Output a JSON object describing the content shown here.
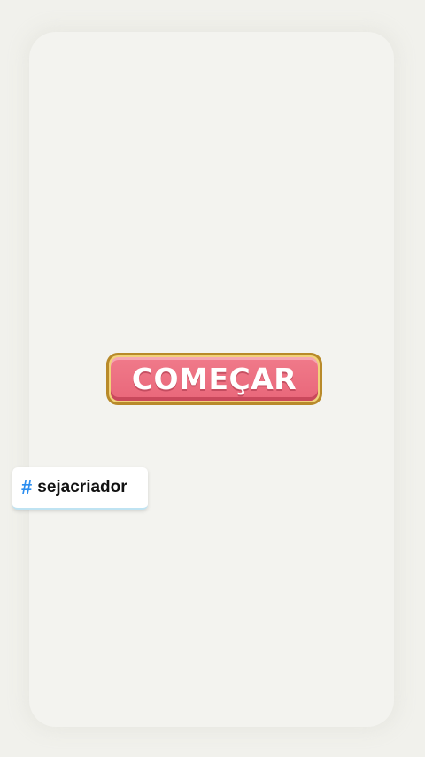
{
  "start_button": {
    "label": "COMEÇAR",
    "colors": {
      "face": "#ec6f82",
      "border_outer": "#b88a2a",
      "border_inner": "#f1d27a",
      "text": "#ffffff"
    }
  },
  "hashtag_sticker": {
    "icon": "hash-icon",
    "symbol": "#",
    "text": "sejacriador",
    "colors": {
      "symbol": "#2b8ef0",
      "text": "#111111",
      "background": "#ffffff"
    }
  },
  "background_color": "#f1f1ec"
}
